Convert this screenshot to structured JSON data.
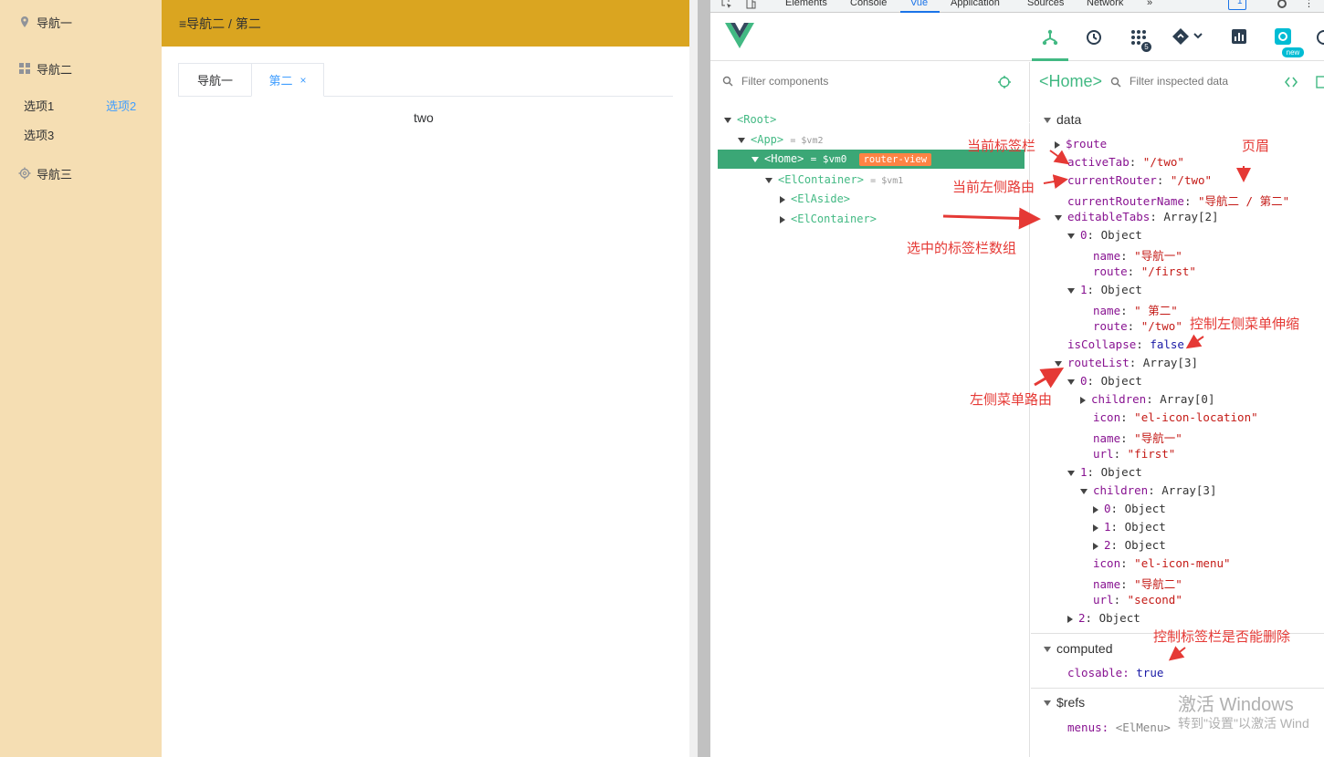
{
  "app": {
    "sidebar": {
      "items": [
        {
          "label": "导航一",
          "icon": "location-icon"
        },
        {
          "label": "导航二",
          "icon": "menu-icon"
        },
        {
          "label": "导航三",
          "icon": "setting-icon"
        }
      ],
      "sub_items": [
        "选项1",
        "选项2",
        "选项3"
      ]
    },
    "header": {
      "title": "≡导航二 / 第二"
    },
    "tabs": [
      {
        "label": "导航一",
        "active": false
      },
      {
        "label": "第二",
        "active": true,
        "close": "×"
      }
    ],
    "content": "two",
    "colors": {
      "aside": "#f5deb3",
      "header": "#daa520",
      "active": "#409eff"
    }
  },
  "devtools": {
    "tabs": [
      "Elements",
      "Console",
      "Vue",
      "Application",
      "Sources",
      "Network",
      "»"
    ],
    "active_tab": "Vue",
    "badge": "1",
    "toolbar_badge": "5",
    "new_label": "new",
    "filter_components": "Filter components",
    "selected_component": "<Home>",
    "filter_inspected": "Filter inspected data",
    "tree": [
      {
        "label": "<Root>",
        "suffix": ""
      },
      {
        "label": "<App>",
        "suffix": "= $vm2"
      },
      {
        "label": "<Home>",
        "suffix": "= $vm0",
        "tag": "router-view"
      },
      {
        "label": "<ElContainer>",
        "suffix": "= $vm1"
      },
      {
        "label": "<ElAside>",
        "suffix": ""
      },
      {
        "label": "<ElContainer>",
        "suffix": ""
      }
    ],
    "sections": {
      "data": "data",
      "computed": "computed",
      "refs": "$refs"
    },
    "data_lines": [
      {
        "key": "$route",
        "value": ""
      },
      {
        "key": "activeTab",
        "value": "\"/two\""
      },
      {
        "key": "currentRouter",
        "value": "\"/two\""
      },
      {
        "key": "currentRouterName",
        "value": "\"导航二 / 第二\""
      },
      {
        "key": "editableTabs",
        "value": "Array[2]"
      },
      {
        "key": "0",
        "value": "Object"
      },
      {
        "key": "name",
        "value": "\"导航一\""
      },
      {
        "key": "route",
        "value": "\"/first\""
      },
      {
        "key": "1",
        "value": "Object"
      },
      {
        "key": "name",
        "value": "\" 第二\""
      },
      {
        "key": "route",
        "value": "\"/two\""
      },
      {
        "key": "isCollapse",
        "value": "false"
      },
      {
        "key": "routeList",
        "value": "Array[3]"
      },
      {
        "key": "0",
        "value": "Object"
      },
      {
        "key": "children",
        "value": "Array[0]"
      },
      {
        "key": "icon",
        "value": "\"el-icon-location\""
      },
      {
        "key": "name",
        "value": "\"导航一\""
      },
      {
        "key": "url",
        "value": "\"first\""
      },
      {
        "key": "1",
        "value": "Object"
      },
      {
        "key": "children",
        "value": "Array[3]"
      },
      {
        "key": "0",
        "value": "Object"
      },
      {
        "key": "1",
        "value": "Object"
      },
      {
        "key": "2",
        "value": "Object"
      },
      {
        "key": "icon",
        "value": "\"el-icon-menu\""
      },
      {
        "key": "name",
        "value": "\"导航二\""
      },
      {
        "key": "url",
        "value": "\"second\""
      },
      {
        "key": "2",
        "value": "Object"
      }
    ],
    "computed_lines": [
      {
        "key": "closable",
        "value": "true"
      }
    ],
    "refs_lines": [
      {
        "key": "menus",
        "value": "<ElMenu>"
      }
    ]
  },
  "annotations": [
    "当前标签栏",
    "页眉",
    "当前左侧路由",
    "选中的标签栏数组",
    "控制左侧菜单伸缩",
    "左侧菜单路由",
    "控制标签栏是否能删除"
  ],
  "watermark": {
    "line1": "激活 Windows",
    "line2": "转到\"设置\"以激活 Wind"
  }
}
